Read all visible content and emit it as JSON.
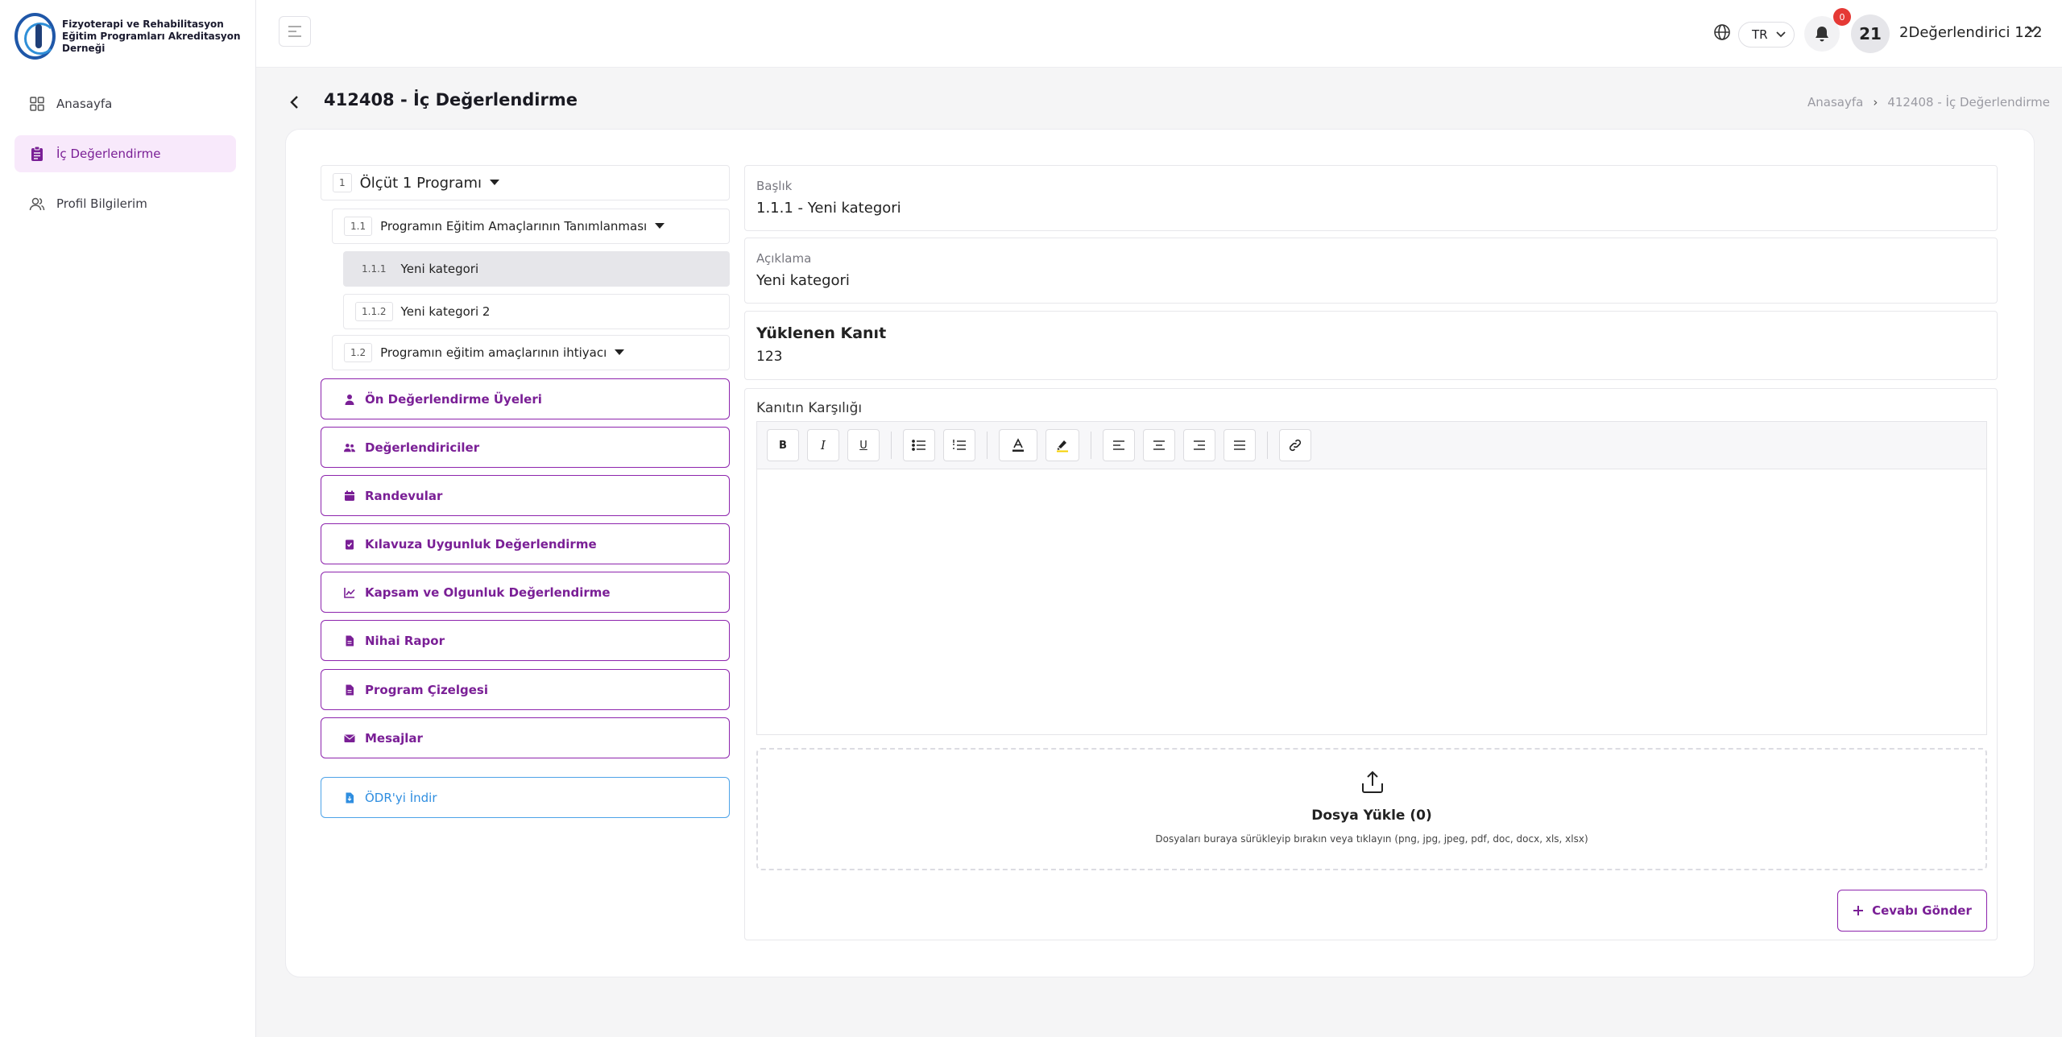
{
  "brand": {
    "line1": "Fizyoterapi ve Rehabilitasyon",
    "line2": "Eğitim Programları Akreditasyon Derneği"
  },
  "sidebar": {
    "items": [
      {
        "label": "Anasayfa",
        "icon": "grid-icon"
      },
      {
        "label": "İç Değerlendirme",
        "icon": "clipboard-icon",
        "active": true
      },
      {
        "label": "Profil Bilgilerim",
        "icon": "users-icon"
      }
    ]
  },
  "header": {
    "language": "TR",
    "notification_count": "0",
    "avatar_initials": "21",
    "user_name": "2Değerlendirici 122"
  },
  "page": {
    "title": "412408 - İç Değerlendirme",
    "breadcrumb": [
      "Anasayfa",
      "412408 - İç Değerlendirme"
    ]
  },
  "tree": {
    "root": {
      "num": "1",
      "label": "Ölçüt 1 Programı"
    },
    "children": [
      {
        "num": "1.1",
        "label": "Programın Eğitim Amaçlarının Tanımlanması"
      },
      {
        "num": "1.1.1",
        "label": "Yeni kategori"
      },
      {
        "num": "1.1.2",
        "label": "Yeni kategori 2"
      },
      {
        "num": "1.2",
        "label": "Programın eğitim amaçlarının ihtiyacı"
      }
    ]
  },
  "actions": [
    {
      "label": "Ön Değerlendirme Üyeleri",
      "icon": "user-icon"
    },
    {
      "label": "Değerlendiriciler",
      "icon": "users-icon"
    },
    {
      "label": "Randevular",
      "icon": "calendar-icon"
    },
    {
      "label": "Kılavuza Uygunluk Değerlendirme",
      "icon": "clipboard-check-icon"
    },
    {
      "label": "Kapsam ve Olgunluk Değerlendirme",
      "icon": "chart-line-icon"
    },
    {
      "label": "Nihai Rapor",
      "icon": "file-icon"
    },
    {
      "label": "Program Çizelgesi",
      "icon": "file-icon"
    },
    {
      "label": "Mesajlar",
      "icon": "envelope-icon"
    }
  ],
  "download": {
    "label": "ÖDR'yi İndir",
    "icon": "file-download-icon"
  },
  "detail": {
    "baslik_label": "Başlık",
    "baslik_value": "1.1.1 - Yeni kategori",
    "aciklama_label": "Açıklama",
    "aciklama_value": "Yeni kategori",
    "kanit_label": "Yüklenen Kanıt",
    "kanit_value": "123"
  },
  "editor": {
    "title": "Kanıtın Karşılığı",
    "tools": [
      "B",
      "I",
      "U"
    ]
  },
  "upload": {
    "title": "Dosya Yükle (0)",
    "hint": "Dosyaları buraya sürükleyip bırakın veya tıklayın (png, jpg, jpeg, pdf, doc, docx, xls, xlsx)"
  },
  "submit": {
    "label": "Cevabı Gönder"
  },
  "colors": {
    "accent": "#7a1f96",
    "accent_bg": "#f8e9fb",
    "link": "#2f8ee0",
    "badge": "#e53935"
  }
}
